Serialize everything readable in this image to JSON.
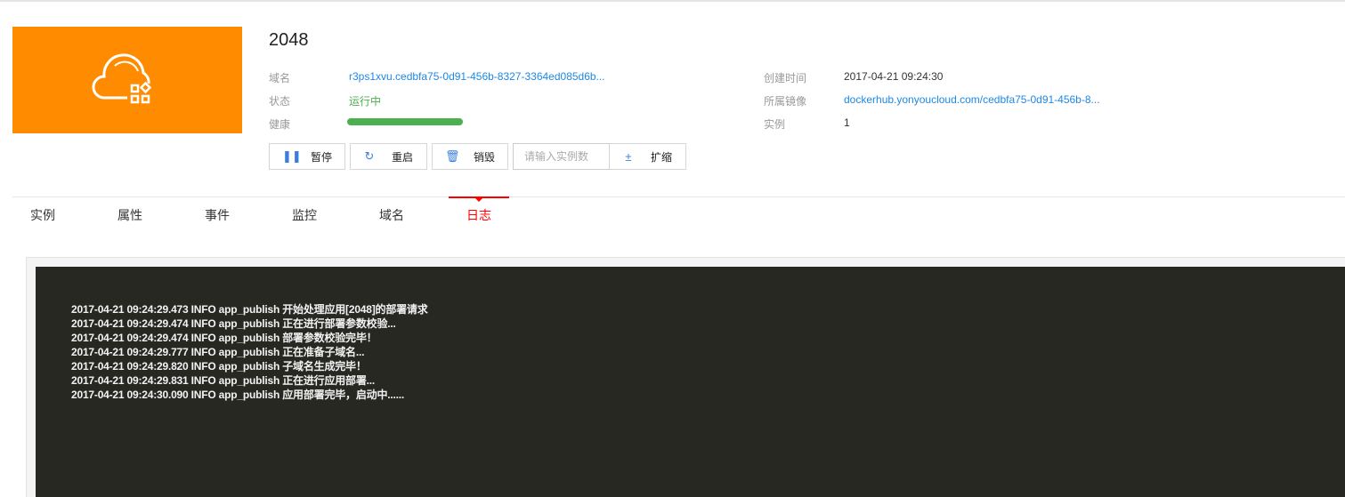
{
  "app": {
    "title": "2048",
    "icon": "cloud-app-icon",
    "icon_bg": "#ff8c00"
  },
  "info": {
    "domain_label": "域名",
    "domain_value": "r3ps1xvu.cedbfa75-0d91-456b-8327-3364ed085d6b...",
    "status_label": "状态",
    "status_value": "运行中",
    "health_label": "健康",
    "health_percent": 100,
    "created_label": "创建时间",
    "created_value": "2017-04-21 09:24:30",
    "image_label": "所属镜像",
    "image_value": "dockerhub.yonyoucloud.com/cedbfa75-0d91-456b-8...",
    "instances_label": "实例",
    "instances_value": "1"
  },
  "actions": {
    "pause": "暂停",
    "restart": "重启",
    "destroy": "销毁",
    "instances_placeholder": "请输入实例数",
    "scale": "扩缩"
  },
  "tabs": [
    {
      "label": "实例"
    },
    {
      "label": "属性"
    },
    {
      "label": "事件"
    },
    {
      "label": "监控"
    },
    {
      "label": "域名"
    },
    {
      "label": "日志",
      "active": true
    }
  ],
  "logs": [
    "2017-04-21 09:24:29.473 INFO app_publish 开始处理应用[2048]的部署请求",
    "2017-04-21 09:24:29.474 INFO app_publish 正在进行部署参数校验...",
    "2017-04-21 09:24:29.474 INFO app_publish 部署参数校验完毕！",
    "2017-04-21 09:24:29.777 INFO app_publish 正在准备子域名...",
    "2017-04-21 09:24:29.820 INFO app_publish 子域名生成完毕！",
    "2017-04-21 09:24:29.831 INFO app_publish 正在进行应用部署...",
    "2017-04-21 09:24:30.090 INFO app_publish 应用部署完毕，启动中......"
  ],
  "colors": {
    "accent": "#ff0000",
    "link": "#1e88e5",
    "ok": "#4caf50",
    "console_bg": "#282823"
  }
}
